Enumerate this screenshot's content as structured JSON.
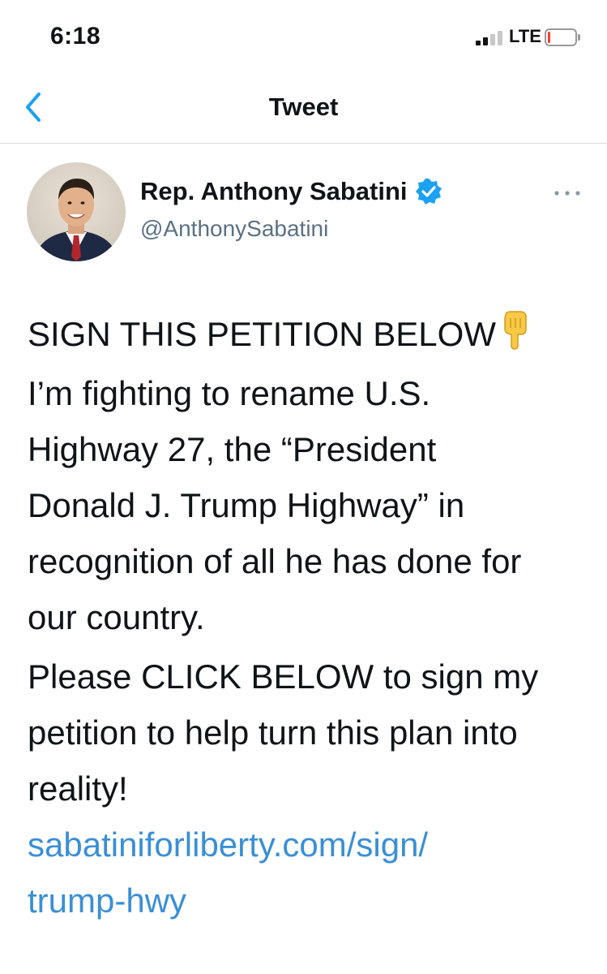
{
  "status_bar": {
    "time": "6:18",
    "network": "LTE",
    "signal_bars_active": 2,
    "signal_bars_total": 4,
    "battery_level": 0.1,
    "battery_color": "#ff3b30"
  },
  "nav": {
    "title": "Tweet",
    "back_icon": "chevron-left-icon",
    "accent_color": "#1da1f2"
  },
  "tweet": {
    "author_name": "Rep. Anthony Sabatini",
    "author_handle": "@AnthonySabatini",
    "verified": true,
    "more_icon": "more-horizontal-icon",
    "paragraphs": [
      {
        "lines": [
          "SIGN THIS PETITION BELOW"
        ],
        "trailing_emoji": "backhand-index-pointing-down"
      },
      {
        "lines": [
          "I’m fighting to rename U.S.",
          "Highway 27, the “President",
          "Donald J. Trump Highway” in",
          "recognition of all he has done for",
          "our country."
        ]
      },
      {
        "lines": [
          "Please CLICK BELOW to sign my",
          "petition to help turn this plan into",
          "reality!"
        ]
      }
    ],
    "link_lines": [
      "sabatiniforliberty.com/sign/",
      "trump-hwy"
    ],
    "link_color": "#3a8fd6"
  }
}
